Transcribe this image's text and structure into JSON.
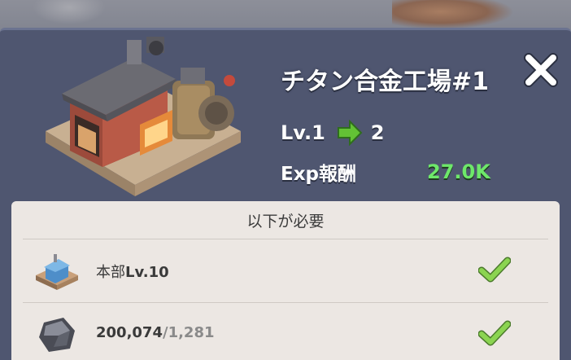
{
  "dialog": {
    "title": "チタン合金工場#1",
    "level": {
      "prefix": "Lv.1",
      "to": "2"
    },
    "exp": {
      "label": "Exp報酬",
      "value": "27.0K"
    }
  },
  "requirements": {
    "header": "以下が必要",
    "items": [
      {
        "name": "本部",
        "suffix": "Lv.10",
        "met": true
      },
      {
        "have": "200,074",
        "sep": "/",
        "need": "1,281",
        "met": true
      }
    ]
  },
  "colors": {
    "dialog_bg": "#4f5670",
    "panel_bg": "#ece7e3",
    "exp_green": "#6ee86a",
    "check_green": "#8bd451"
  },
  "icons": [
    "building-icon",
    "close-icon",
    "arrow-right-icon",
    "headquarters-icon",
    "titanium-ore-icon",
    "checkmark-icon"
  ]
}
